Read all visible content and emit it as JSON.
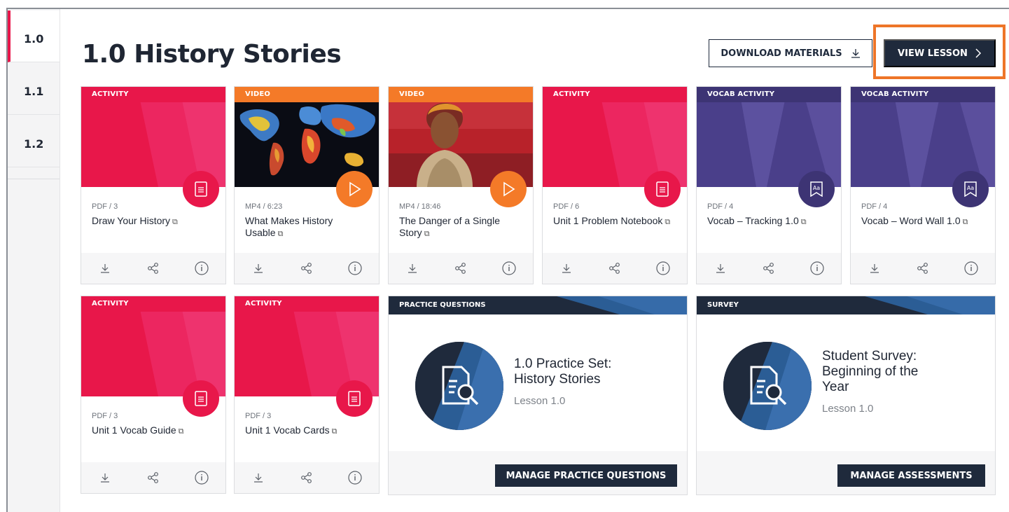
{
  "sidebar": {
    "items": [
      {
        "label": "1.0"
      },
      {
        "label": "1.1"
      },
      {
        "label": "1.2"
      }
    ]
  },
  "header": {
    "title": "1.0 History Stories",
    "download_label": "DOWNLOAD MATERIALS",
    "view_label": "VIEW LESSON"
  },
  "cards": [
    {
      "tag": "ACTIVITY",
      "meta": "PDF / 3",
      "name": "Draw Your History",
      "icon": "document-icon"
    },
    {
      "tag": "VIDEO",
      "meta": "MP4 / 6:23",
      "name": "What Makes History Usable",
      "icon": "play-icon"
    },
    {
      "tag": "VIDEO",
      "meta": "MP4 / 18:46",
      "name": "The Danger of a Single Story",
      "icon": "play-icon"
    },
    {
      "tag": "ACTIVITY",
      "meta": "PDF / 6",
      "name": "Unit 1 Problem Notebook",
      "icon": "document-icon"
    },
    {
      "tag": "VOCAB ACTIVITY",
      "meta": "PDF / 4",
      "name": "Vocab – Tracking 1.0",
      "icon": "vocab-icon"
    },
    {
      "tag": "VOCAB ACTIVITY",
      "meta": "PDF / 4",
      "name": "Vocab – Word Wall 1.0",
      "icon": "vocab-icon"
    },
    {
      "tag": "ACTIVITY",
      "meta": "PDF / 3",
      "name": "Unit 1 Vocab Guide",
      "icon": "document-icon"
    },
    {
      "tag": "ACTIVITY",
      "meta": "PDF / 3",
      "name": "Unit 1 Vocab Cards",
      "icon": "document-icon"
    }
  ],
  "wide_cards": [
    {
      "tag": "PRACTICE QUESTIONS",
      "title": "1.0 Practice Set: History Stories",
      "sub": "Lesson 1.0",
      "button": "MANAGE PRACTICE QUESTIONS",
      "icon": "document-search-icon"
    },
    {
      "tag": "SURVEY",
      "title": "Student Survey: Beginning of the Year",
      "sub": "Lesson 1.0",
      "button": "MANAGE ASSESSMENTS",
      "icon": "document-search-icon"
    }
  ],
  "colors": {
    "accent_red": "#e8174a",
    "accent_orange": "#f47a28",
    "accent_purple": "#3d3474",
    "navy": "#1f2a3c",
    "highlight": "#ee7528"
  }
}
